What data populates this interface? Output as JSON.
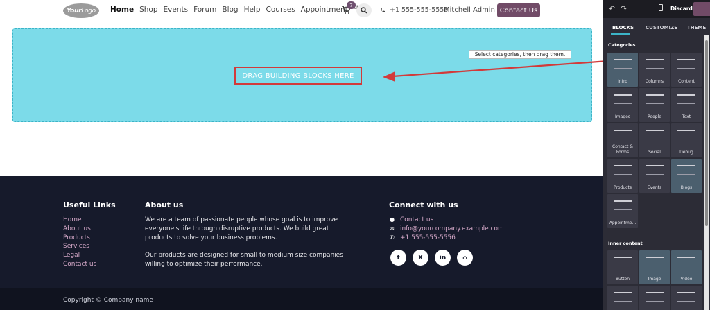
{
  "nav": {
    "logo_text_a": "Your",
    "logo_text_b": "Logo",
    "items": [
      "Home",
      "Shop",
      "Events",
      "Forum",
      "Blog",
      "Help",
      "Courses",
      "Appointment"
    ],
    "plus_label": "+",
    "cart_count": "7",
    "phone": "+1 555-555-5556",
    "user": "Mitchell Admin",
    "contact_button": "Contact Us"
  },
  "dropzone": {
    "label": "DRAG BUILDING BLOCKS HERE",
    "tooltip": "Select categories, then drag them."
  },
  "footer": {
    "useful_links_title": "Useful Links",
    "useful_links": [
      "Home",
      "About us",
      "Products",
      "Services",
      "Legal",
      "Contact us"
    ],
    "about_title": "About us",
    "about_p1": "We are a team of passionate people whose goal is to improve everyone's life through disruptive products. We build great products to solve your business problems.",
    "about_p2": "Our products are designed for small to medium size companies willing to optimize their performance.",
    "connect_title": "Connect with us",
    "connect_items": [
      "Contact us",
      "info@yourcompany.example.com",
      "+1 555-555-5556"
    ],
    "socials": [
      "f",
      "X",
      "in",
      "⌂"
    ],
    "copyright": "Copyright © Company name"
  },
  "panel": {
    "discard": "Discard",
    "tabs": [
      "BLOCKS",
      "CUSTOMIZE",
      "THEME"
    ],
    "categories_title": "Categories",
    "categories": [
      "Intro",
      "Columns",
      "Content",
      "Images",
      "People",
      "Text",
      "Contact & Forms",
      "Social",
      "Debug",
      "Products",
      "Events",
      "Blogs",
      "Appointme..."
    ],
    "inner_title": "Inner content",
    "inner": [
      "Button",
      "Image",
      "Video"
    ]
  },
  "colors": {
    "brand": "#714b67",
    "dropzone": "#7cdbe9",
    "footer": "#161a2b",
    "panel": "#2c2c36",
    "highlight_border": "#d23a3a"
  }
}
